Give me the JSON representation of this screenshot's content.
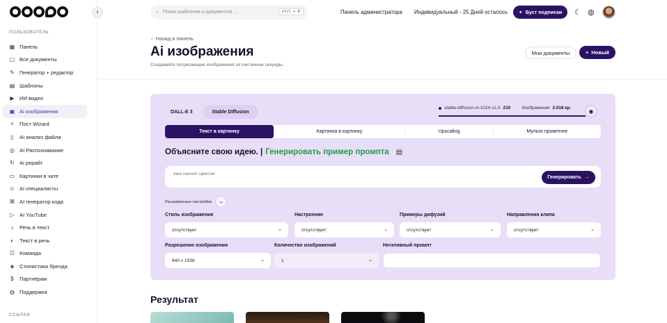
{
  "sidebar": {
    "section_users": "ПОЛЬЗОВАТЕЛЬ",
    "section_links": "ССЫЛКИ",
    "items": [
      {
        "label": "Панель",
        "icon": "grid-icon"
      },
      {
        "label": "Все документы",
        "icon": "folder-icon"
      },
      {
        "label": "Генератор + редактор",
        "icon": "edit-icon"
      },
      {
        "label": "Шаблоны",
        "icon": "template-icon"
      },
      {
        "label": "ИИ видео",
        "icon": "video-icon"
      },
      {
        "label": "Ai изображения",
        "icon": "image-icon",
        "active": true
      },
      {
        "label": "Пост Wizard",
        "icon": "wand-icon"
      },
      {
        "label": "AI анализ файла",
        "icon": "file-icon"
      },
      {
        "label": "AI Распознавание",
        "icon": "scan-icon"
      },
      {
        "label": "Ai рерайт",
        "icon": "rewrite-icon"
      },
      {
        "label": "Картинки в чате",
        "icon": "chat-image-icon"
      },
      {
        "label": "Ai специалисты",
        "icon": "specialist-icon"
      },
      {
        "label": "AI генератор кода",
        "icon": "code-icon"
      },
      {
        "label": "AI YouTube",
        "icon": "youtube-icon"
      },
      {
        "label": "Речь в текст",
        "icon": "microphone-icon"
      },
      {
        "label": "Текст в речь",
        "icon": "speaker-icon"
      },
      {
        "label": "Команда",
        "icon": "team-icon"
      },
      {
        "label": "Стилистика бренда",
        "icon": "palette-icon"
      },
      {
        "label": "Партнёрам",
        "icon": "dollar-icon"
      },
      {
        "label": "Поддержка",
        "icon": "support-icon"
      }
    ]
  },
  "topbar": {
    "search_placeholder": "Поиск шаблонов и документов ...",
    "search_shortcut": "ctrl + K",
    "admin_panel": "Панель администратора",
    "plan_status": "Индивидуальный - 25 Дней осталось",
    "boost_label": "Буст подписки"
  },
  "header": {
    "back_label": "Назад в панель",
    "title": "Ai изображения",
    "subtitle": "Создавайте потрясающие изображения за считанные секунды.",
    "my_docs_label": "Мои документы",
    "new_label": "Новый"
  },
  "generator": {
    "model_tabs": [
      "DALL-E 3",
      "Stable Diffusion"
    ],
    "active_model_index": 1,
    "model_name": "stable-diffusion-xl-1024-v1-0",
    "model_count": "210",
    "images_label": "Изображения",
    "images_remaining": "2.018 кр.",
    "mode_tabs": [
      "Текст в картинку",
      "Картинка в картинку",
      "Upscaling",
      "Мульти промптинг"
    ],
    "explain_title": "Объясните свою идею. |",
    "generate_example_label": "Генерировать пример промпта",
    "prompt_placeholder": "ежа пахнет цветом",
    "generate_label": "Генерировать",
    "advanced_label": "Расширенные настройки",
    "fields": {
      "style": {
        "label": "Стиль изображения",
        "value": "отсутствует"
      },
      "mood": {
        "label": "Настроение",
        "value": "отсутствует"
      },
      "diffusion_examples": {
        "label": "Примеры дифузий",
        "value": "отсутствует"
      },
      "clip_direction": {
        "label": "Направления клипа",
        "value": "отсутствует"
      },
      "resolution": {
        "label": "Разрешение изображения",
        "value": "640 x 1536"
      },
      "image_count": {
        "label": "Количество изображений",
        "value": "1"
      },
      "negative_prompt": {
        "label": "Негативный промпт",
        "value": ""
      }
    }
  },
  "results": {
    "title": "Результат"
  },
  "colors": {
    "primary": "#2b1263",
    "card_bg": "#e9def8",
    "accent_green": "#1f9d4a",
    "active_nav": "#4a2db3"
  }
}
